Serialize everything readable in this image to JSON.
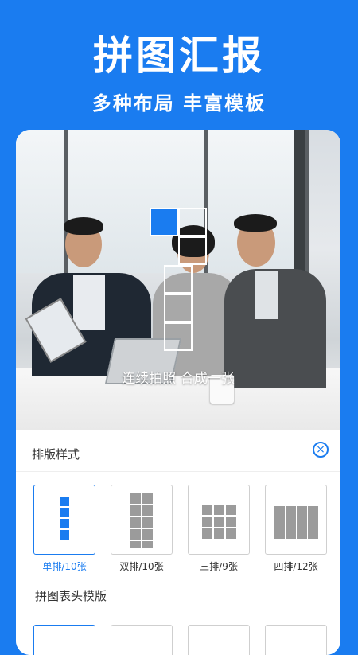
{
  "promo": {
    "title": "拼图汇报",
    "subtitle": "多种布局 丰富模板"
  },
  "photo": {
    "caption": "连续拍照 合成一张"
  },
  "layout_panel": {
    "title": "排版样式",
    "options": [
      {
        "label": "单排/10张",
        "selected": true
      },
      {
        "label": "双排/10张",
        "selected": false
      },
      {
        "label": "三排/9张",
        "selected": false
      },
      {
        "label": "四排/12张",
        "selected": false
      }
    ]
  },
  "header_templates": {
    "title": "拼图表头模版"
  },
  "colors": {
    "brand": "#1a7cf0",
    "tile_grey": "#9b9b9b"
  }
}
